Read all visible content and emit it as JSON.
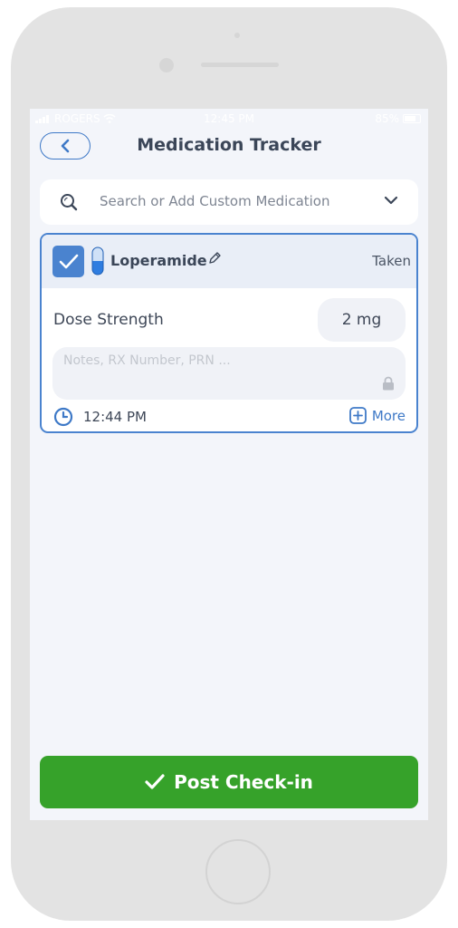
{
  "status_bar": {
    "carrier": "ROGERS",
    "time": "12:45 PM",
    "battery": "85%"
  },
  "header": {
    "title": "Medication Tracker",
    "back_icon": "chevron-left-icon"
  },
  "search": {
    "placeholder": "Search or Add Custom Medication",
    "icon": "search-icon",
    "dropdown_icon": "chevron-down-icon"
  },
  "medication": {
    "checked": true,
    "name": "Loperamide",
    "status": "Taken",
    "dose_label": "Dose Strength",
    "dose_value": "2 mg",
    "notes_placeholder": "Notes, RX Number, PRN ...",
    "time": "12:44 PM",
    "more_label": "More"
  },
  "footer": {
    "post_label": "Post Check-in"
  },
  "colors": {
    "accent": "#3e79c7",
    "checkbox": "#4a83cf",
    "post_button": "#36a22a",
    "background": "#f3f5fa"
  }
}
